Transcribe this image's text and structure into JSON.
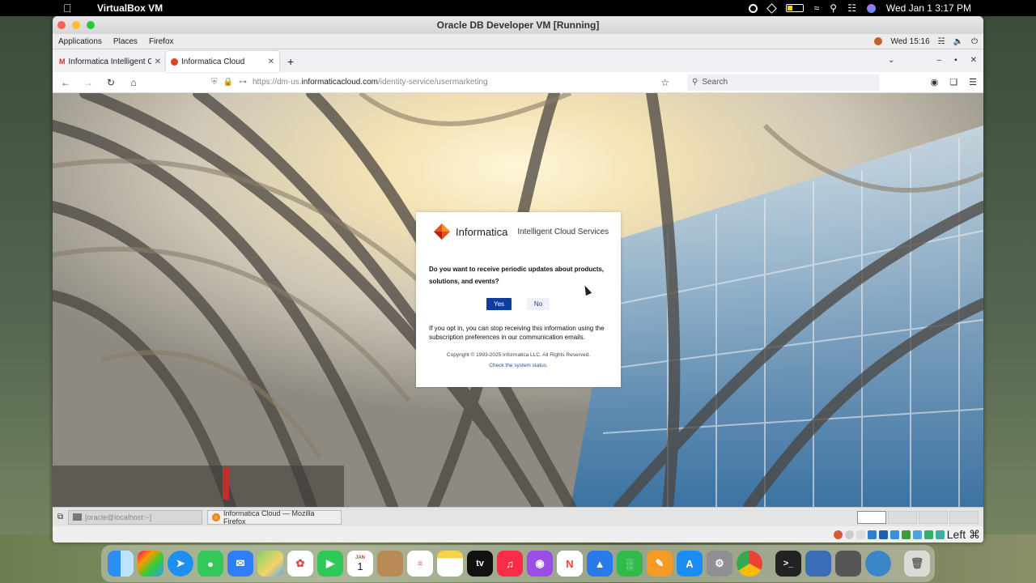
{
  "mac_menubar": {
    "app_name": "VirtualBox VM",
    "clock": "Wed Jan 1  3:17 PM"
  },
  "vm_window": {
    "title": "Oracle DB Developer VM [Running]"
  },
  "gnome_bar": {
    "menus": [
      "Applications",
      "Places",
      "Firefox"
    ],
    "clock": "Wed 15:16"
  },
  "browser": {
    "tabs": [
      {
        "label": "Informatica Intelligent Clo",
        "active": false
      },
      {
        "label": "Informatica Cloud",
        "active": true
      }
    ],
    "url_prefix": "https://dm-us.",
    "url_domain": "informaticacloud.com",
    "url_path": "/identity-service/usermarketing",
    "search_placeholder": "Search"
  },
  "dialog": {
    "brand": "Informatica",
    "service": "Intelligent Cloud Services",
    "question": "Do you want to receive periodic updates about products, solutions, and events?",
    "yes_label": "Yes",
    "no_label": "No",
    "note": "If you opt in, you can stop receiving this information using the subscription preferences in our communication emails.",
    "copyright": "Copyright © 1993-2025 Informatica LLC. All Rights Reserved.",
    "status_link": "Check the system status."
  },
  "taskbar": {
    "items": [
      "[oracle@localhost:~]",
      "Informatica Cloud — Mozilla Firefox"
    ]
  },
  "vbox_status": {
    "host_key": "Left ⌘"
  },
  "dock": {
    "calendar_month": "JAN",
    "calendar_day": "1",
    "tv_label": "tv"
  },
  "colors": {
    "yes_button": "#0d3d9e",
    "link": "#1f4fb0",
    "informatica_orange": "#e8501e"
  }
}
